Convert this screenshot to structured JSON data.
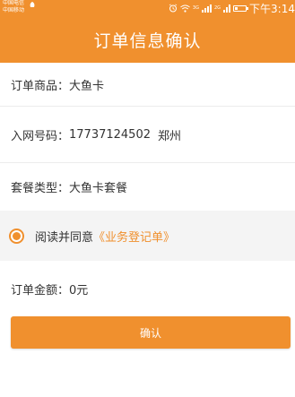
{
  "status_bar": {
    "carrier_line_1": "中国电信",
    "carrier_line_2": "中国移动",
    "network_label_1": "3G",
    "network_label_2": "2G",
    "time": "下午3:14",
    "icons": [
      "carrier-logo-icon",
      "alarm-icon",
      "wifi-icon",
      "signal-icon",
      "battery-icon"
    ]
  },
  "header": {
    "title": "订单信息确认"
  },
  "order": {
    "product_label": "订单商品：",
    "product_value": "大鱼卡",
    "number_label": "入网号码：",
    "number_value": "17737124502",
    "number_city": "郑州",
    "package_label": "套餐类型：",
    "package_value": "大鱼卡套餐",
    "agree_text": "阅读并同意",
    "agree_link": "《业务登记单》",
    "agree_checked": true,
    "amount_label": "订单金额：",
    "amount_value": "0元"
  },
  "actions": {
    "confirm_label": "确认"
  },
  "colors": {
    "accent": "#f0902e",
    "text": "#333333",
    "agree_background": "#f4f4f4",
    "divider": "#ececec"
  }
}
